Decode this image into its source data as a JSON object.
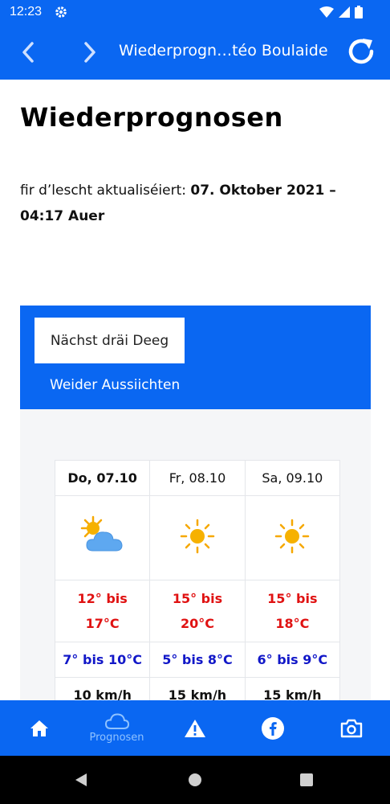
{
  "status_bar": {
    "time": "12:23"
  },
  "app_bar": {
    "title": "Wiederprogn…téo Boulaide"
  },
  "page": {
    "title": "Wiederprognosen",
    "updated_prefix": "fir d’lescht aktualiséiert: ",
    "updated_value": "07. Oktober 2021 – 04:17 Auer"
  },
  "tabs": {
    "active": "Nächst dräi Deeg",
    "other": "Weider Aussiichten"
  },
  "forecast": {
    "days": [
      {
        "label": "Do, 07.10",
        "icon": "sun-cloud-icon",
        "temp_line1": "12° bis",
        "temp_line2": "17°C",
        "water": "7° bis 10°C",
        "wind": "10 km/h"
      },
      {
        "label": "Fr, 08.10",
        "icon": "sun-icon",
        "temp_line1": "15° bis",
        "temp_line2": "20°C",
        "water": "5° bis 8°C",
        "wind": "15 km/h"
      },
      {
        "label": "Sa, 09.10",
        "icon": "sun-icon",
        "temp_line1": "15° bis",
        "temp_line2": "18°C",
        "water": "6° bis 9°C",
        "wind": "15 km/h"
      }
    ]
  },
  "bottom_nav": {
    "items": [
      {
        "icon": "home-icon",
        "label": ""
      },
      {
        "icon": "cloud-icon",
        "label": "Prognosen"
      },
      {
        "icon": "warning-icon",
        "label": ""
      },
      {
        "icon": "facebook-icon",
        "label": ""
      },
      {
        "icon": "camera-icon",
        "label": ""
      }
    ]
  },
  "colors": {
    "primary": "#0a67f2",
    "temp_red": "#e01212",
    "water_blue": "#1218c8",
    "active_nav": "#8fc2ff"
  }
}
